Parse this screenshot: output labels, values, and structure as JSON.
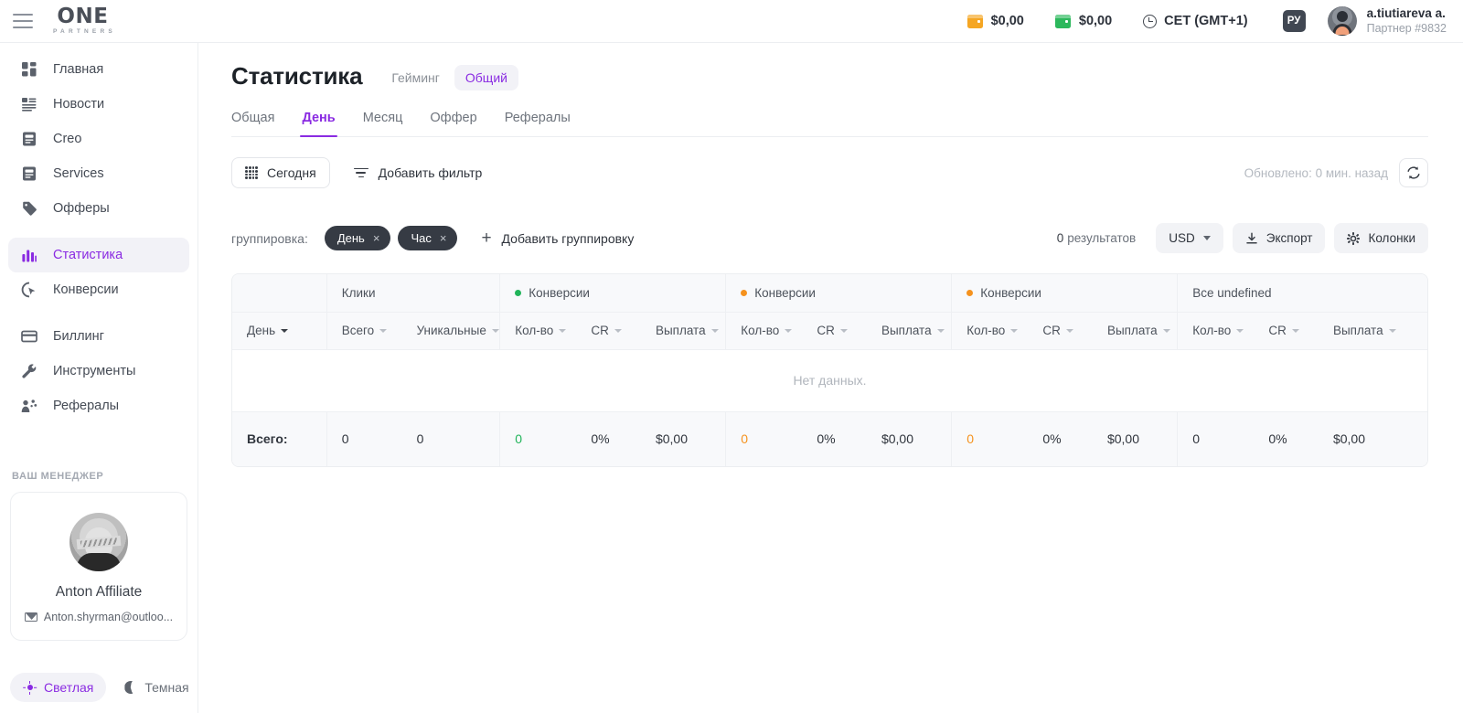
{
  "topbar": {
    "menu_icon": "hamburger-icon",
    "logo": {
      "main": "ONE",
      "sub": "PARTNERS"
    },
    "balances": [
      {
        "icon": "wallet-orange-icon",
        "value": "$0,00"
      },
      {
        "icon": "wallet-green-icon",
        "value": "$0,00"
      }
    ],
    "timezone": {
      "icon": "clock-icon",
      "label": "CET (GMT+1)"
    },
    "language": "РУ",
    "user": {
      "name": "a.tiutiareva a.",
      "role": "Партнер #9832",
      "avatar": "avatar"
    }
  },
  "sidebar": {
    "items": [
      {
        "label": "Главная",
        "icon": "dashboard-icon",
        "active": false
      },
      {
        "label": "Новости",
        "icon": "news-icon",
        "active": false
      },
      {
        "label": "Creo",
        "icon": "document-icon",
        "active": false
      },
      {
        "label": "Services",
        "icon": "document-icon",
        "active": false
      },
      {
        "label": "Офферы",
        "icon": "tag-icon",
        "active": false
      },
      {
        "label": "Статистика",
        "icon": "bar-chart-icon",
        "active": true
      },
      {
        "label": "Конверсии",
        "icon": "cursor-click-icon",
        "active": false
      },
      {
        "label": "Биллинг",
        "icon": "credit-card-icon",
        "active": false
      },
      {
        "label": "Инструменты",
        "icon": "wrench-icon",
        "active": false
      },
      {
        "label": "Рефералы",
        "icon": "referral-icon",
        "active": false
      }
    ],
    "manager": {
      "section_title": "ВАШ МЕНЕДЖЕР",
      "name": "Anton Affiliate",
      "email": "Anton.shyrman@outloo...",
      "mail_icon": "envelope-icon"
    },
    "theme": {
      "light": {
        "label": "Светлая",
        "icon": "sun-icon",
        "active": true
      },
      "dark": {
        "label": "Темная",
        "icon": "moon-icon",
        "active": false
      }
    }
  },
  "page": {
    "title": "Статистика",
    "segments": [
      {
        "label": "Гейминг",
        "active": false
      },
      {
        "label": "Общий",
        "active": true
      }
    ],
    "tabs": [
      {
        "label": "Общая",
        "active": false
      },
      {
        "label": "День",
        "active": true
      },
      {
        "label": "Месяц",
        "active": false
      },
      {
        "label": "Оффер",
        "active": false
      },
      {
        "label": "Рефералы",
        "active": false
      }
    ]
  },
  "filters": {
    "date_button": {
      "label": "Сегодня",
      "icon": "calendar-dots-icon"
    },
    "add_filter": {
      "label": "Добавить фильтр",
      "icon": "filter-icon"
    },
    "updated_text": "Обновлено: 0 мин. назад",
    "refresh_icon": "refresh-icon"
  },
  "grouping": {
    "label": "группировка:",
    "chips": [
      {
        "label": "День",
        "remove": "×"
      },
      {
        "label": "Час",
        "remove": "×"
      }
    ],
    "add_label": "Добавить группировку",
    "add_icon": "plus-icon",
    "results_count": "0",
    "results_label": "результатов",
    "currency": {
      "value": "USD",
      "icon": "chevron-down-icon"
    },
    "export": {
      "label": "Экспорт",
      "icon": "download-icon"
    },
    "columns": {
      "label": "Колонки",
      "icon": "gear-icon"
    }
  },
  "table": {
    "groups": [
      {
        "label": "",
        "dot": "",
        "span": 1
      },
      {
        "label": "Клики",
        "dot": "",
        "span": 2
      },
      {
        "label": "Конверсии",
        "dot": "green",
        "span": 3
      },
      {
        "label": "Конверсии",
        "dot": "orange",
        "span": 3
      },
      {
        "label": "Конверсии",
        "dot": "orange",
        "span": 3
      },
      {
        "label": "Все undefined",
        "dot": "",
        "span": 3
      }
    ],
    "subheaders": [
      "День",
      "Всего",
      "Уникальные",
      "Кол-во",
      "CR",
      "Выплата",
      "Кол-во",
      "CR",
      "Выплата",
      "Кол-во",
      "CR",
      "Выплата",
      "Кол-во",
      "CR",
      "Выплата"
    ],
    "empty_text": "Нет данных.",
    "totals": {
      "label": "Всего:",
      "values": [
        "0",
        "0",
        "0",
        "0%",
        "$0,00",
        "0",
        "0%",
        "$0,00",
        "0",
        "0%",
        "$0,00",
        "0",
        "0%",
        "$0,00"
      ],
      "value_colors": [
        "",
        "",
        "green",
        "",
        "",
        "orange",
        "",
        "",
        "orange",
        "",
        "",
        "",
        "",
        ""
      ]
    }
  },
  "colors": {
    "accent": "#8a2be2",
    "green": "#21b45a",
    "orange": "#f5921e",
    "chip_bg": "#363b44"
  }
}
